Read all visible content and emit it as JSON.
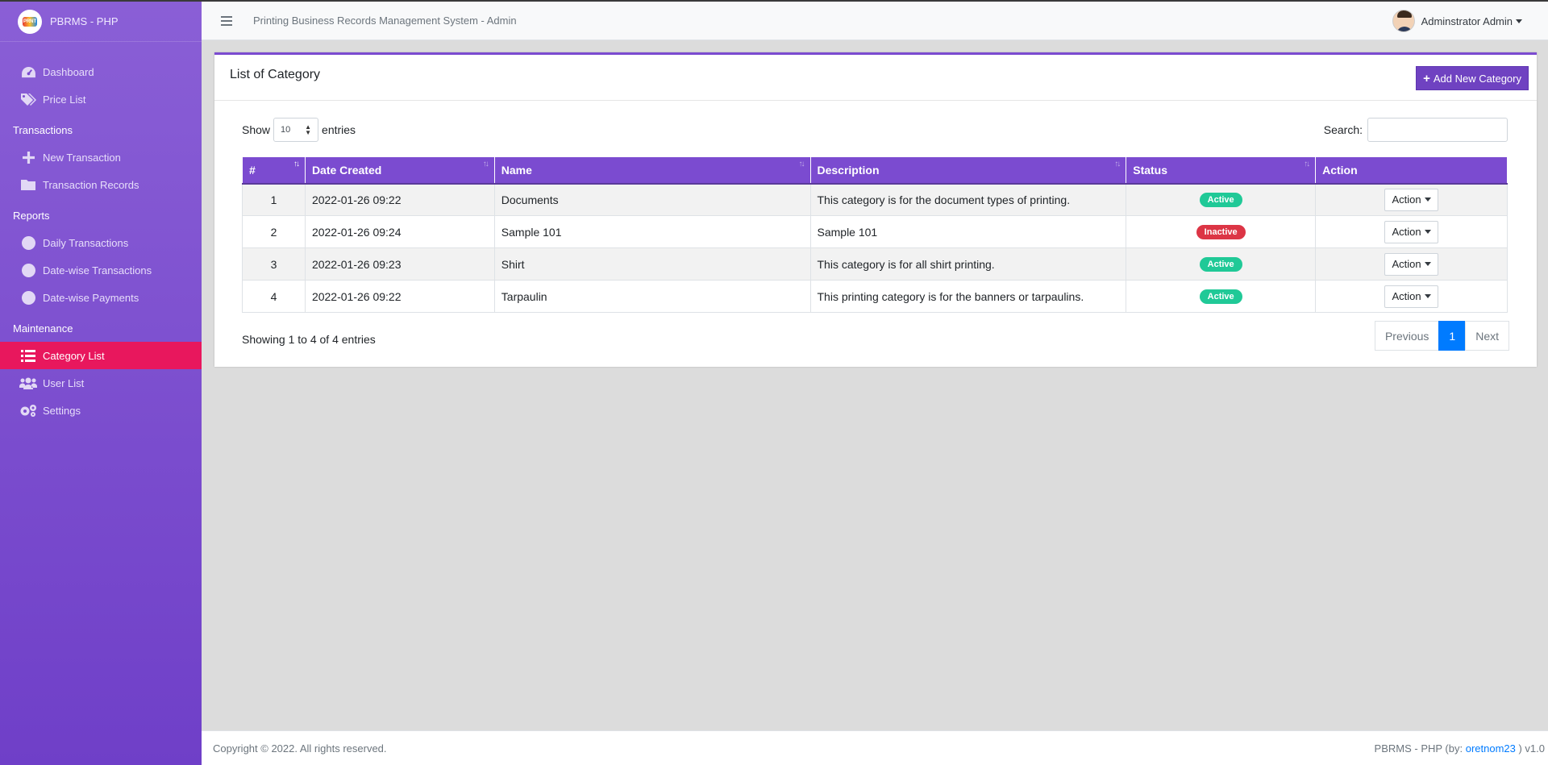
{
  "brand": {
    "name": "PBRMS - PHP",
    "logo_text": "PRNT"
  },
  "topbar": {
    "title": "Printing Business Records Management System - Admin",
    "user": "Adminstrator Admin"
  },
  "sidebar": {
    "items": [
      {
        "label": "Dashboard",
        "icon": "dashboard-icon"
      },
      {
        "label": "Price List",
        "icon": "tags-icon"
      }
    ],
    "sections": [
      {
        "header": "Transactions",
        "items": [
          {
            "label": "New Transaction",
            "icon": "plus-icon"
          },
          {
            "label": "Transaction Records",
            "icon": "folder-icon"
          }
        ]
      },
      {
        "header": "Reports",
        "items": [
          {
            "label": "Daily Transactions",
            "icon": "circle-icon"
          },
          {
            "label": "Date-wise Transactions",
            "icon": "circle-icon"
          },
          {
            "label": "Date-wise Payments",
            "icon": "circle-icon"
          }
        ]
      },
      {
        "header": "Maintenance",
        "items": [
          {
            "label": "Category List",
            "icon": "list-icon",
            "active": true
          },
          {
            "label": "User List",
            "icon": "users-icon"
          },
          {
            "label": "Settings",
            "icon": "cogs-icon"
          }
        ]
      }
    ]
  },
  "card": {
    "title": "List of Category",
    "add_button": "Add New Category"
  },
  "controls": {
    "show_label": "Show",
    "entries_value": "10",
    "entries_label": "entries",
    "search_label": "Search:"
  },
  "table": {
    "headers": [
      "#",
      "Date Created",
      "Name",
      "Description",
      "Status",
      "Action"
    ],
    "rows": [
      {
        "num": "1",
        "date": "2022-01-26 09:22",
        "name": "Documents",
        "description": "This category is for the document types of printing.",
        "status": "Active",
        "action": "Action"
      },
      {
        "num": "2",
        "date": "2022-01-26 09:24",
        "name": "Sample 101",
        "description": "Sample 101",
        "status": "Inactive",
        "action": "Action"
      },
      {
        "num": "3",
        "date": "2022-01-26 09:23",
        "name": "Shirt",
        "description": "This category is for all shirt printing.",
        "status": "Active",
        "action": "Action"
      },
      {
        "num": "4",
        "date": "2022-01-26 09:22",
        "name": "Tarpaulin",
        "description": "This printing category is for the banners or tarpaulins.",
        "status": "Active",
        "action": "Action"
      }
    ]
  },
  "info": "Showing 1 to 4 of 4 entries",
  "pagination": {
    "previous": "Previous",
    "current": "1",
    "next": "Next"
  },
  "footer": {
    "copyright": "Copyright © 2022. All rights reserved.",
    "right_prefix": "PBRMS - PHP (by: ",
    "author": "oretnom23",
    "right_suffix": " ) v1.0"
  },
  "colors": {
    "sidebar": "#7b4bd0",
    "active_nav": "#e8175d",
    "accent": "#6f42c1",
    "active_badge": "#20c997",
    "inactive_badge": "#dc3545",
    "page_current": "#007bff"
  }
}
